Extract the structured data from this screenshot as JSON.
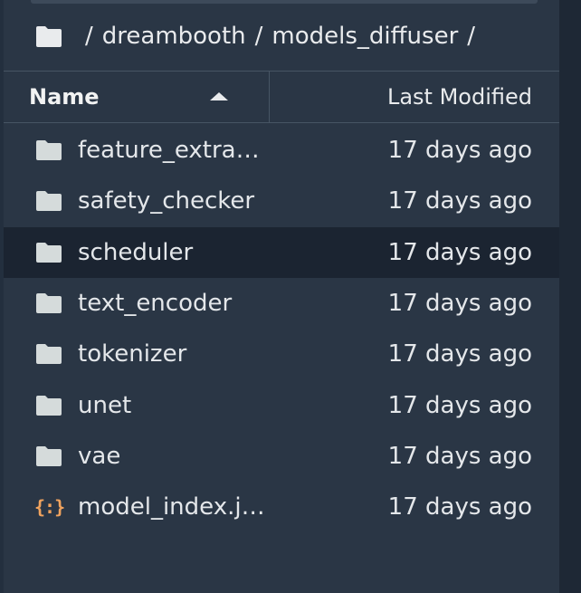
{
  "breadcrumb": {
    "root_icon": "folder-icon",
    "separator": "/",
    "segments": [
      "dreambooth",
      "models_diffuser"
    ]
  },
  "table": {
    "header": {
      "name_label": "Name",
      "modified_label": "Last Modified",
      "sort": "ascending"
    },
    "rows": [
      {
        "icon": "folder-icon",
        "name": "feature_extra…",
        "modified": "17 days ago",
        "selected": false
      },
      {
        "icon": "folder-icon",
        "name": "safety_checker",
        "modified": "17 days ago",
        "selected": false
      },
      {
        "icon": "folder-icon",
        "name": "scheduler",
        "modified": "17 days ago",
        "selected": true
      },
      {
        "icon": "folder-icon",
        "name": "text_encoder",
        "modified": "17 days ago",
        "selected": false
      },
      {
        "icon": "folder-icon",
        "name": "tokenizer",
        "modified": "17 days ago",
        "selected": false
      },
      {
        "icon": "folder-icon",
        "name": "unet",
        "modified": "17 days ago",
        "selected": false
      },
      {
        "icon": "folder-icon",
        "name": "vae",
        "modified": "17 days ago",
        "selected": false
      },
      {
        "icon": "json-file-icon",
        "name": "model_index.j…",
        "modified": "17 days ago",
        "selected": false
      }
    ]
  },
  "colors": {
    "panel_bg": "#2a3645",
    "selected_row_bg": "#1b2431",
    "json_icon": "#f0a35e",
    "folder_icon": "#d5dbdb"
  }
}
